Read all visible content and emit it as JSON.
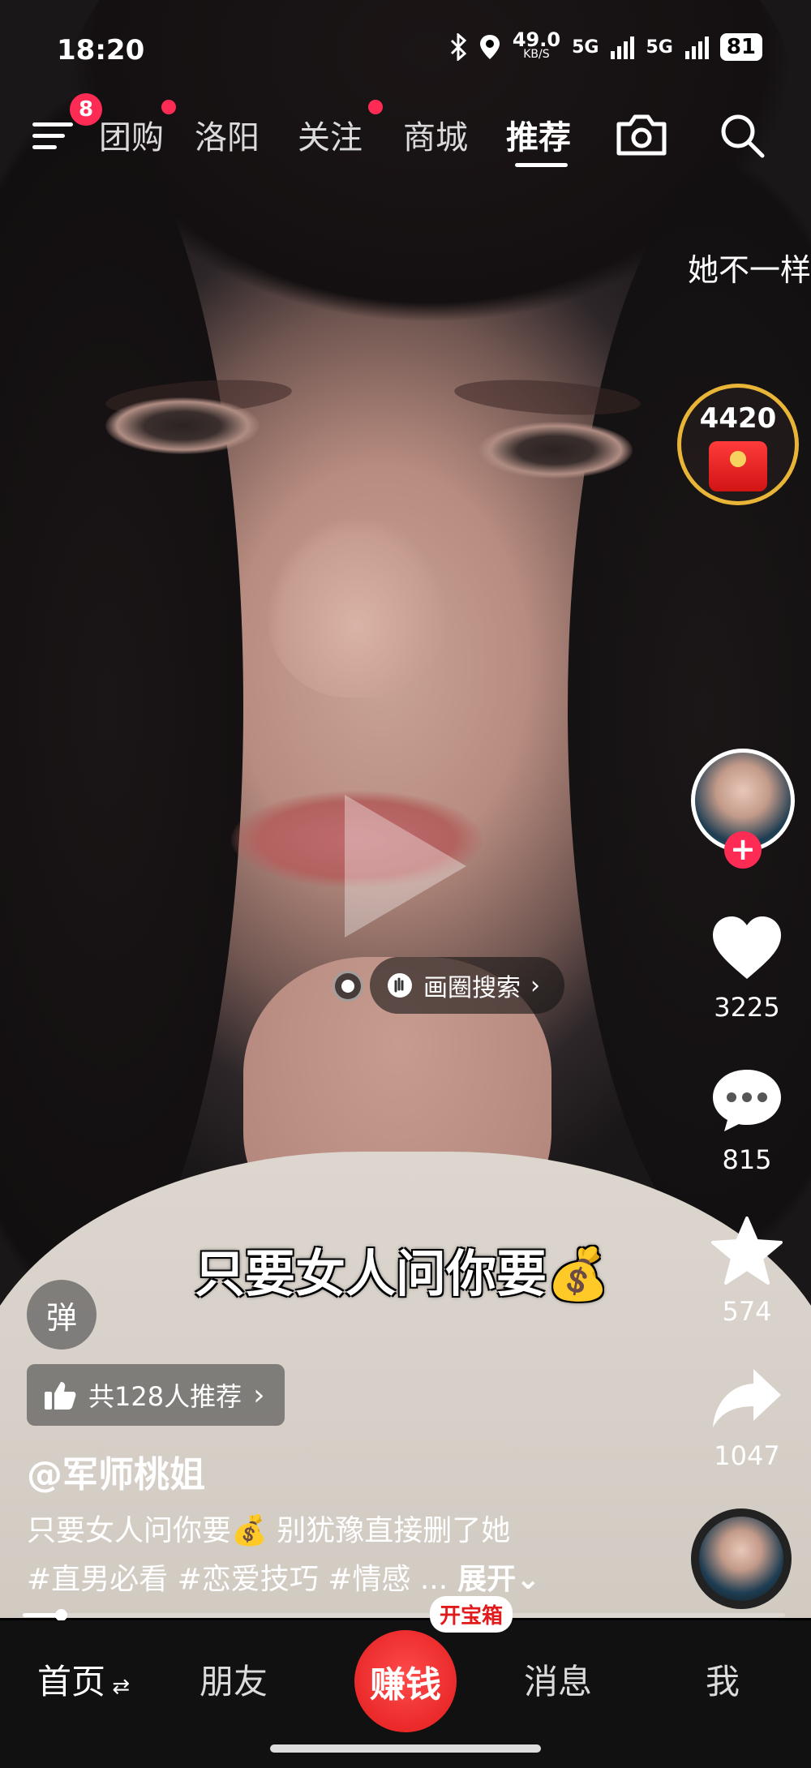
{
  "status_bar": {
    "time": "18:20",
    "net_speed_value": "49.0",
    "net_speed_unit": "KB/S",
    "sim1": "5G",
    "sim2": "5G",
    "battery": "81"
  },
  "top_nav": {
    "menu_badge": "8",
    "tabs": [
      {
        "label": "团购",
        "dot": true
      },
      {
        "label": "洛阳",
        "dot": false
      },
      {
        "label": "关注",
        "dot": true
      },
      {
        "label": "商城",
        "dot": false
      },
      {
        "label": "推荐",
        "dot": false,
        "active": true
      }
    ],
    "icons": [
      "menu-icon",
      "camera-icon",
      "search-icon"
    ]
  },
  "side_text": "她不一样",
  "reward": {
    "count": "4420",
    "icon": "red-envelope-icon"
  },
  "rail": {
    "likes": "3225",
    "comments": "815",
    "favorites": "574",
    "shares": "1047"
  },
  "circle_search": {
    "label": "画圈搜索"
  },
  "caption_big": "只要女人问你要💰",
  "danmu_label": "弹",
  "recommend": {
    "label": "共128人推荐"
  },
  "author": "@军师桃姐",
  "description": {
    "line1": "只要女人问你要💰 别犹豫直接删了她",
    "line2": "#直男必看 #恋爱技巧 #情感 ...",
    "more": "展开"
  },
  "progress": {
    "fraction": 0.05
  },
  "bottom_nav": {
    "home": "首页",
    "friends": "朋友",
    "earn": "赚钱",
    "treasure": "开宝箱",
    "messages": "消息",
    "me": "我"
  },
  "colors": {
    "accent": "#fe2c55",
    "earn_red": "#e11b1b"
  }
}
